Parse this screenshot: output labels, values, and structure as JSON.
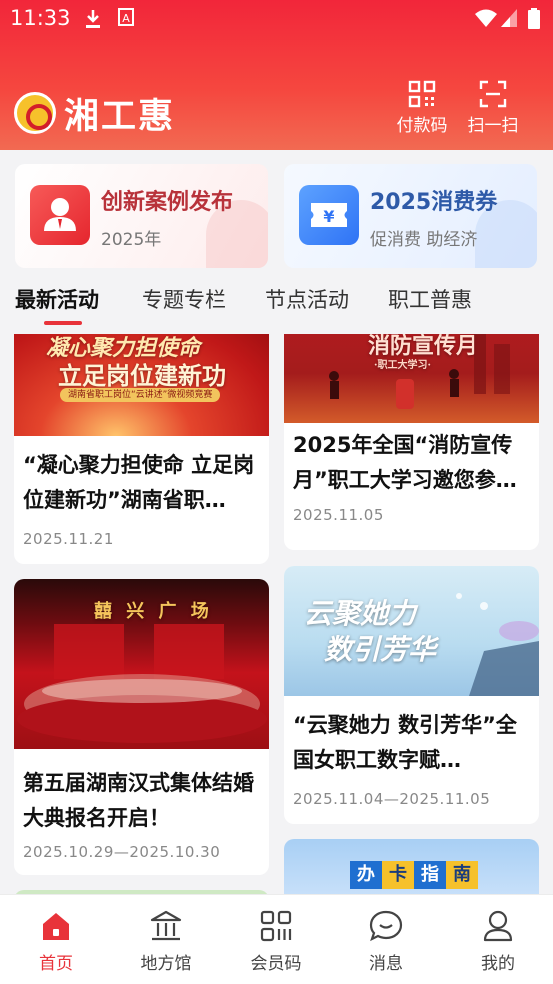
{
  "status_bar": {
    "time": "11:33",
    "icons": [
      "download-icon",
      "a-icon",
      "wifi-icon",
      "signal-icon",
      "battery-icon"
    ]
  },
  "header": {
    "app_title": "湘工惠",
    "pay_code_label": "付款码",
    "scan_label": "扫一扫"
  },
  "promos": [
    {
      "title": "创新案例发布",
      "subtitle": "2025年",
      "icon": "person-icon"
    },
    {
      "title": "2025消费券",
      "subtitle": "促消费 助经济",
      "icon": "coupon-yen-icon"
    }
  ],
  "tabs": [
    {
      "label": "最新活动",
      "active": true
    },
    {
      "label": "专题专栏",
      "active": false
    },
    {
      "label": "节点活动",
      "active": false
    },
    {
      "label": "职工普惠",
      "active": false
    }
  ],
  "feed": {
    "left": [
      {
        "image_text": [
          "凝心聚力担使命",
          "立足岗位建新功"
        ],
        "image_caption": "湖南省职工岗位“云讲述”微视频竞赛",
        "title": "“凝心聚力担使命  立足岗位建新功”湖南省职…",
        "date": "2025.11.21"
      },
      {
        "image_text": [
          "囍 兴 广 场"
        ],
        "title": "第五届湖南汉式集体结婚大典报名开启！",
        "date": "2025.10.29—2025.10.30"
      }
    ],
    "right": [
      {
        "image_text": [
          "消防宣传月",
          "·职工大学习·"
        ],
        "title": "2025年全国“消防宣传月”职工大学习邀您参…",
        "date": "2025.11.05"
      },
      {
        "image_text": [
          "云聚她力",
          "数引芳华"
        ],
        "title": "“云聚她力  数引芳华”全国女职工数字赋…",
        "date": "2025.11.04—2025.11.05"
      },
      {
        "image_text": [
          "办",
          "卡",
          "指",
          "南"
        ]
      }
    ]
  },
  "bottom_nav": [
    {
      "label": "首页",
      "icon": "home-icon",
      "active": true
    },
    {
      "label": "地方馆",
      "icon": "building-icon",
      "active": false
    },
    {
      "label": "会员码",
      "icon": "member-code-icon",
      "active": false
    },
    {
      "label": "消息",
      "icon": "message-icon",
      "active": false
    },
    {
      "label": "我的",
      "icon": "profile-icon",
      "active": false
    }
  ],
  "colors": {
    "brand_red": "#e8333a",
    "header_red": "#f2263a",
    "promo_blue": "#2e5aa8"
  }
}
